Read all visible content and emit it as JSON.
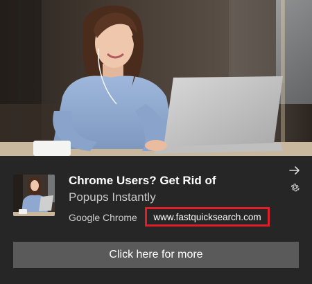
{
  "notification": {
    "title": "Chrome Users? Get Rid of",
    "subtitle": "Popups Instantly",
    "source": "Google Chrome",
    "url": "www.fastquicksearch.com",
    "button_label": "Click here for more",
    "icons": {
      "dismiss": "arrow-right-icon",
      "settings": "gear-icon"
    },
    "colors": {
      "background": "#262626",
      "button": "#5a5a5a",
      "highlight_border": "#e01e2a"
    }
  }
}
